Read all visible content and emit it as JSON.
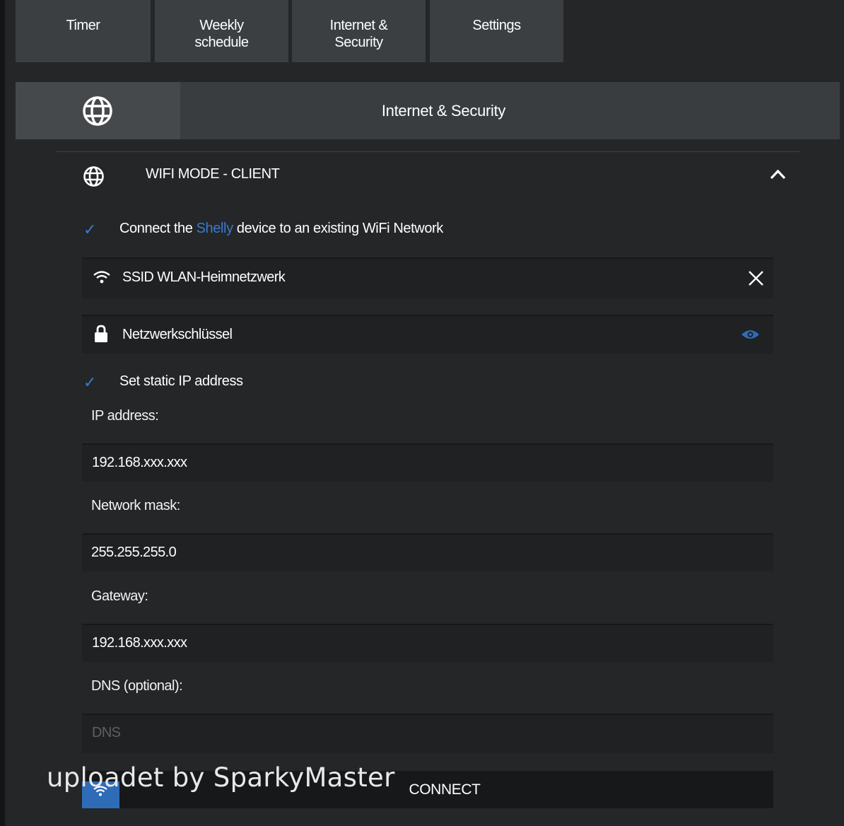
{
  "tabs": [
    {
      "label_line1": "Timer",
      "label_line2": ""
    },
    {
      "label_line1": "Weekly",
      "label_line2": "schedule"
    },
    {
      "label_line1": "Internet &",
      "label_line2": "Security"
    },
    {
      "label_line1": "Settings",
      "label_line2": ""
    }
  ],
  "section": {
    "title": "Internet & Security",
    "icon": "globe-icon"
  },
  "wifi_client": {
    "header": "WIFI MODE - CLIENT",
    "header_icon": "globe-icon",
    "collapse_icon": "chevron-up-icon",
    "connect_checkbox": {
      "checked": true,
      "text_before": "Connect the ",
      "brand": "Shelly",
      "text_after": " device to an existing WiFi Network"
    },
    "ssid": {
      "icon": "wifi-icon",
      "value": "SSID WLAN-Heimnetzwerk",
      "clear_icon": "close-icon"
    },
    "password": {
      "icon": "lock-icon",
      "placeholder": "Netzwerkschlüssel",
      "toggle_icon": "eye-icon"
    },
    "static_ip_checkbox": {
      "checked": true,
      "label": "Set static IP address"
    },
    "ip_label": "IP address:",
    "ip_value": "192.168.xxx.xxx",
    "mask_label": "Network mask:",
    "mask_value": "255.255.255.0",
    "gateway_label": "Gateway:",
    "gateway_value": "192.168.xxx.xxx",
    "dns_label": "DNS (optional):",
    "dns_placeholder": "DNS",
    "connect_button": "CONNECT",
    "connect_icon": "wifi-icon"
  },
  "watermark": "uploadet by SparkyMaster",
  "colors": {
    "background": "#242628",
    "tab_bg": "#3c3f42",
    "accent": "#3a7ad0",
    "field_bg": "#1f2123"
  }
}
